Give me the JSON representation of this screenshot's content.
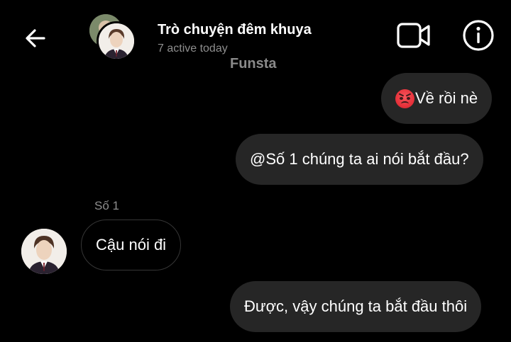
{
  "header": {
    "back_icon": "arrow-left-icon",
    "title": "Trò chuyện đêm khuya",
    "subtitle": "7 active today",
    "video_icon": "video-camera-icon",
    "info_icon": "info-icon"
  },
  "watermark": "Funsta",
  "messages": [
    {
      "direction": "outgoing",
      "emoji": "angry-face",
      "text": "Về rồi nè"
    },
    {
      "direction": "outgoing",
      "text": "@Số 1 chúng ta ai nói bắt đầu?"
    },
    {
      "direction": "incoming",
      "sender": "Số 1",
      "text": "Cậu nói đi"
    },
    {
      "direction": "outgoing",
      "text": "Được, vậy chúng ta bắt đầu thôi"
    }
  ],
  "colors": {
    "background": "#000000",
    "outgoing_bubble": "#262626",
    "incoming_bubble_border": "#363636",
    "secondary_text": "#8e8e8e",
    "text": "#ffffff"
  }
}
